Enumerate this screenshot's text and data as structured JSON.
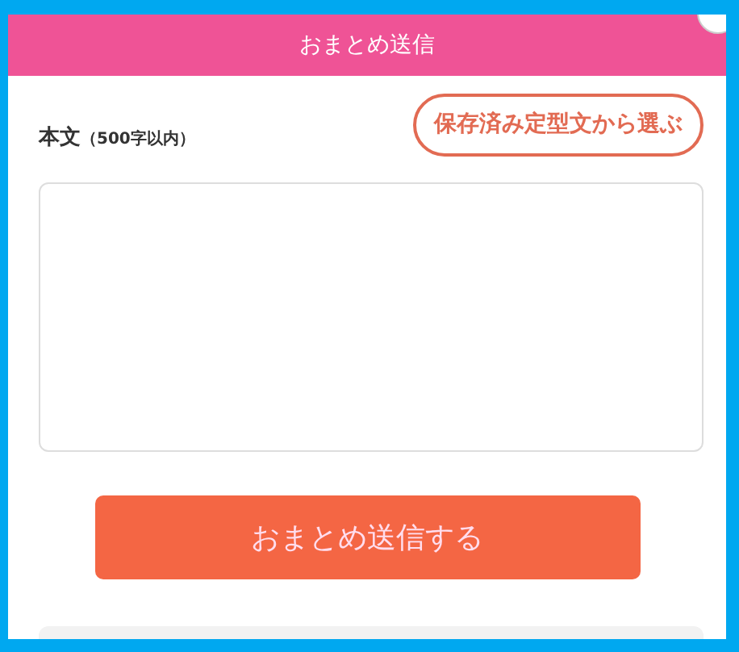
{
  "modal": {
    "title": "おまとめ送信"
  },
  "template_button": "保存済み定型文から選ぶ",
  "body_label": "本文",
  "body_note": "（500字以内）",
  "submit_button": "おまとめ送信する"
}
